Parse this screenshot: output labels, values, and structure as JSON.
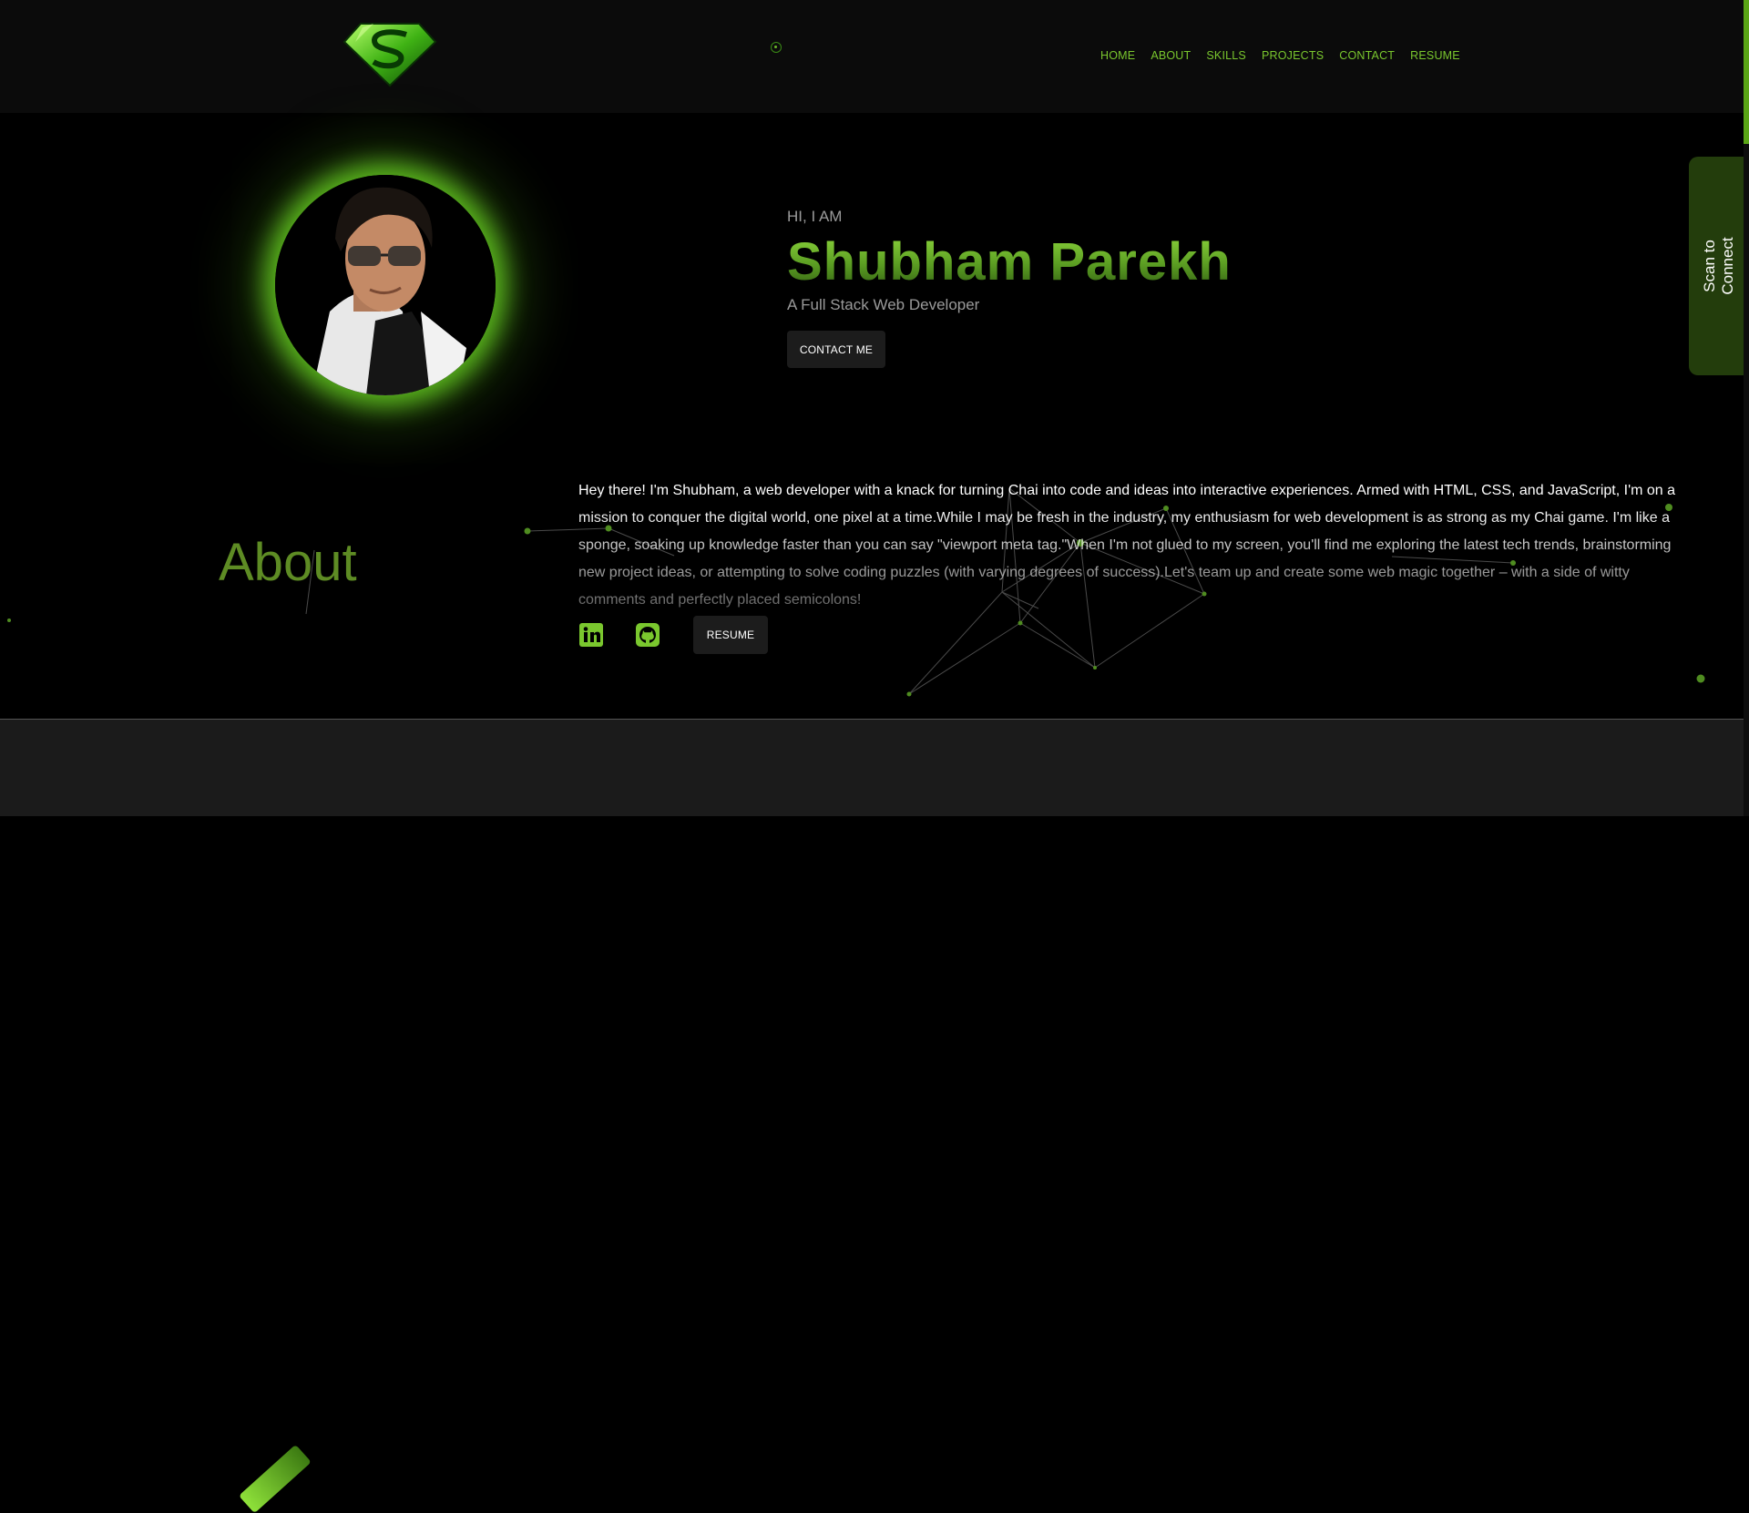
{
  "nav": {
    "items": [
      "HOME",
      "ABOUT",
      "SKILLS",
      "PROJECTS",
      "CONTACT",
      "RESUME"
    ]
  },
  "hero": {
    "greeting": "HI, I AM",
    "name": "Shubham Parekh",
    "role": "A Full Stack Web Developer",
    "contact_button": "CONTACT ME"
  },
  "scan_tab": {
    "line1": "Scan to",
    "line2": "Connect"
  },
  "about": {
    "title": "About",
    "text": "Hey there! I'm Shubham, a web developer with a knack for turning Chai into code and ideas into interactive experiences. Armed with HTML, CSS, and JavaScript, I'm on a mission to conquer the digital world, one pixel at a time.While I may be fresh in the industry, my enthusiasm for web development is as strong as my Chai game. I'm like a sponge, soaking up knowledge faster than you can say \"viewport meta tag.\"When I'm not glued to my screen, you'll find me exploring the latest tech trends, brainstorming new project ideas, or attempting to solve coding puzzles (with varying degrees of success).Let's team up and create some web magic together – with a side of witty comments and perfectly placed semicolons!",
    "resume_button": "RESUME"
  },
  "colors": {
    "accent": "#7ac72e",
    "background": "#000000",
    "header": "#0b0b0b",
    "scan_tab": "#233d0c"
  },
  "icons": [
    "superman-logo-icon",
    "linkedin-icon",
    "github-icon"
  ]
}
